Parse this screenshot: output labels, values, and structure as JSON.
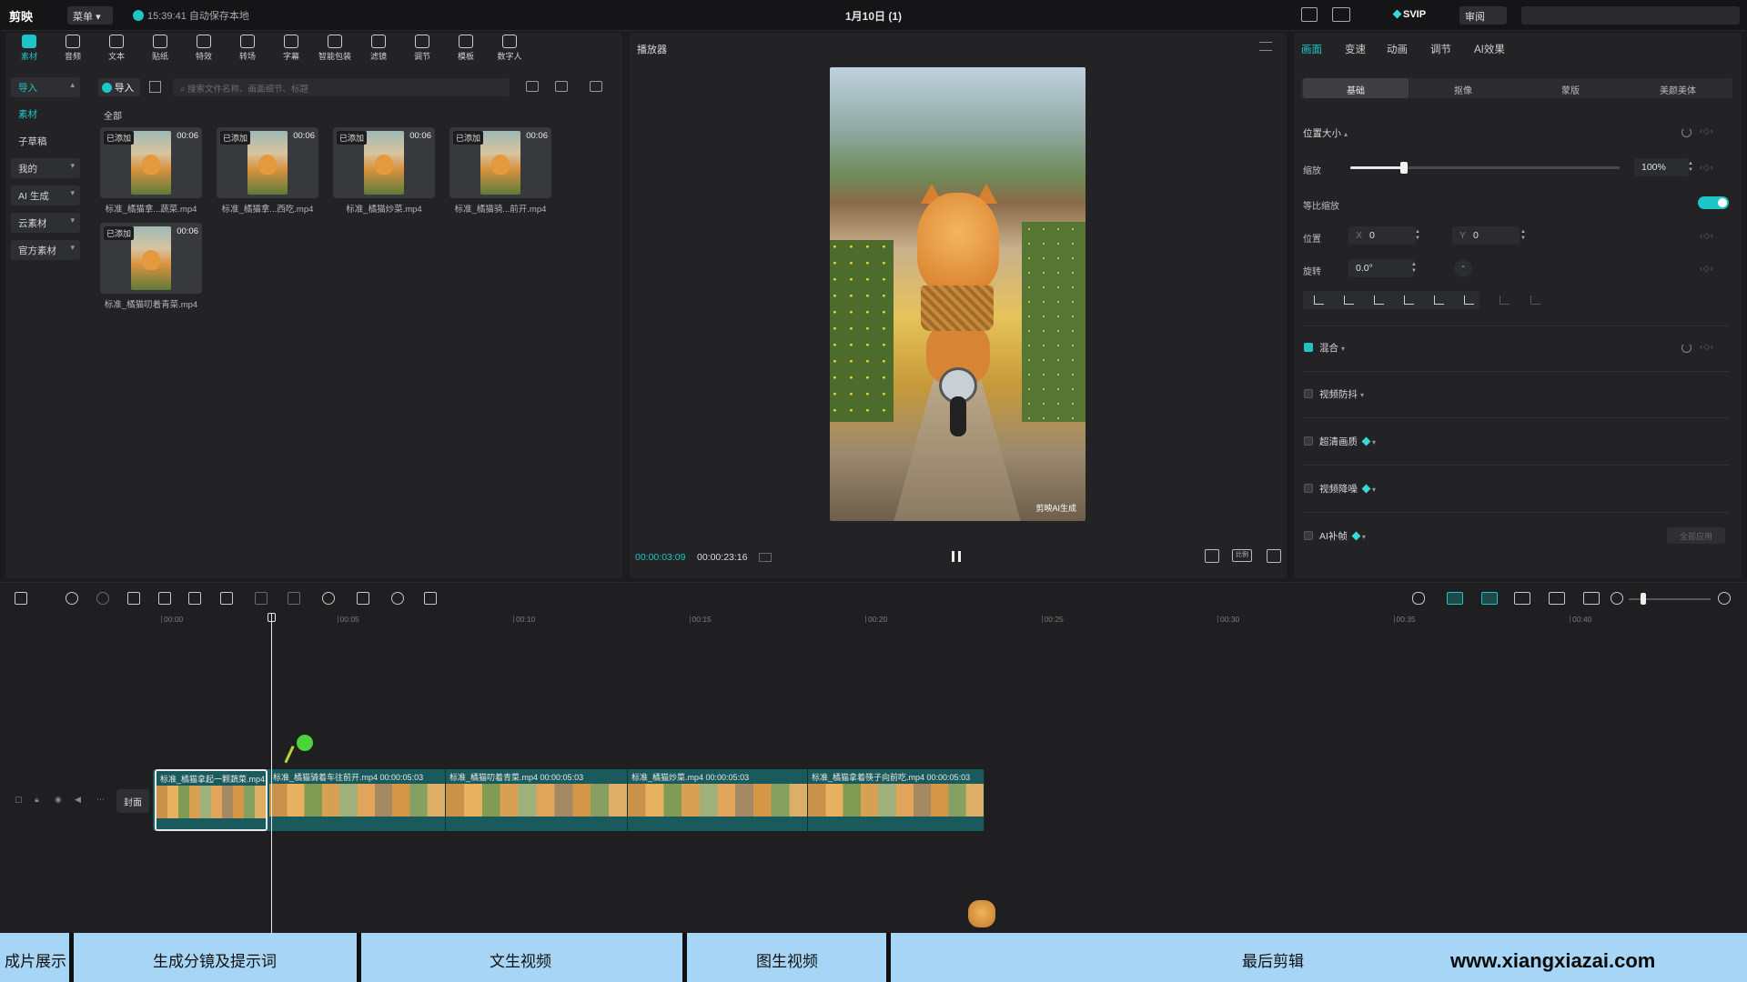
{
  "titlebar": {
    "logo": "剪映",
    "menu_label": "菜单",
    "autosave": "15:39:41 自动保存本地",
    "project_title": "1月10日 (1)",
    "svip": "SVIP",
    "review": "审阅"
  },
  "toolbar": {
    "items": [
      {
        "label": "素材",
        "icon": "media-icon"
      },
      {
        "label": "音频",
        "icon": "audio-icon"
      },
      {
        "label": "文本",
        "icon": "text-icon"
      },
      {
        "label": "贴纸",
        "icon": "sticker-icon"
      },
      {
        "label": "特效",
        "icon": "effects-icon"
      },
      {
        "label": "转场",
        "icon": "transition-icon"
      },
      {
        "label": "字幕",
        "icon": "subtitle-icon"
      },
      {
        "label": "智能包装",
        "icon": "smart-pack-icon"
      },
      {
        "label": "滤镜",
        "icon": "filter-icon"
      },
      {
        "label": "调节",
        "icon": "adjust-icon"
      },
      {
        "label": "模板",
        "icon": "template-icon"
      },
      {
        "label": "数字人",
        "icon": "avatar-icon"
      }
    ]
  },
  "sidebar": {
    "items": [
      {
        "label": "导入"
      },
      {
        "label": "素材"
      },
      {
        "label": "子草稿"
      },
      {
        "label": "我的"
      },
      {
        "label": "AI 生成"
      },
      {
        "label": "云素材"
      },
      {
        "label": "官方素材"
      }
    ]
  },
  "media_panel": {
    "import_label": "导入",
    "search_placeholder": "搜索文件名称、画面细节、标题",
    "all_label": "全部",
    "items": [
      {
        "badge": "已添加",
        "duration": "00:06",
        "name": "标准_橘猫拿...蔬菜.mp4"
      },
      {
        "badge": "已添加",
        "duration": "00:06",
        "name": "标准_橘猫拿...西吃.mp4"
      },
      {
        "badge": "已添加",
        "duration": "00:06",
        "name": "标准_橘猫炒菜.mp4"
      },
      {
        "badge": "已添加",
        "duration": "00:06",
        "name": "标准_橘猫骑...前开.mp4"
      },
      {
        "badge": "已添加",
        "duration": "00:06",
        "name": "标准_橘猫叨着青菜.mp4"
      }
    ]
  },
  "player": {
    "title": "播放器",
    "current_time": "00:00:03:09",
    "total_time": "00:00:23:16",
    "ratio_label": "比例",
    "watermark": "剪映AI生成"
  },
  "inspector": {
    "tabs": [
      "画面",
      "变速",
      "动画",
      "调节",
      "AI效果"
    ],
    "subtabs": [
      "基础",
      "抠像",
      "蒙版",
      "美颜美体"
    ],
    "position_size": "位置大小",
    "scale_label": "缩放",
    "scale_value": "100%",
    "scale_level": 0.2,
    "uniform_scale": "等比缩放",
    "position_label": "位置",
    "x_axis": "X",
    "x_value": "0",
    "y_axis": "Y",
    "y_value": "0",
    "rotate_label": "旋转",
    "rotate_value": "0.0°",
    "rotate_dial": "-",
    "blend": "混合",
    "stabilize": "视频防抖",
    "super_res": "超清画质",
    "denoise": "视频降噪",
    "ai_frame": "AI补帧",
    "apply_all": "全部应用"
  },
  "timeline": {
    "ticks": [
      "00:00",
      "00:05",
      "00:10",
      "00:15",
      "00:20",
      "00:25",
      "00:30",
      "00:35",
      "00:40"
    ],
    "cover_label": "封面",
    "clips": [
      {
        "name": "标准_橘猫拿起一颗蔬菜.mp4",
        "duration": ""
      },
      {
        "name": "标准_橘猫骑着车往前开.mp4",
        "duration": "00:00:05:03"
      },
      {
        "name": "标准_橘猫叨着青菜.mp4",
        "duration": "00:00:05:03"
      },
      {
        "name": "标准_橘猫炒菜.mp4",
        "duration": "00:00:05:03"
      },
      {
        "name": "标准_橘猫拿着筷子向前吃.mp4",
        "duration": "00:00:05:03"
      }
    ]
  },
  "steps": [
    "成片展示",
    "生成分镜及提示词",
    "文生视频",
    "图生视频",
    "最后剪辑"
  ],
  "site": "www.xiangxiazai.com",
  "colors": {
    "accent": "#1fc4c4",
    "step_bar": "#a6d5f5",
    "clip": "#1a5a5c"
  }
}
